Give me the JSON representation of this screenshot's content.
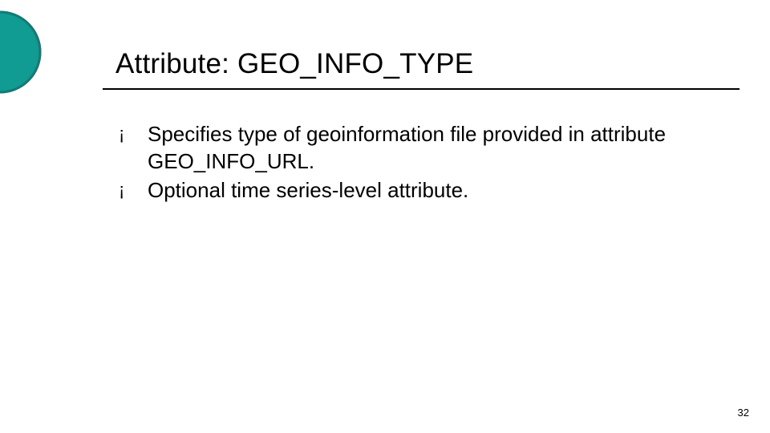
{
  "slide": {
    "title": "Attribute: GEO_INFO_TYPE",
    "bullets": [
      "Specifies type of geoinformation file provided in attribute GEO_INFO_URL.",
      "Optional time series-level attribute."
    ],
    "page_number": "32",
    "bullet_glyph": "¡"
  },
  "theme": {
    "accent": "#0d7d77",
    "accent_fill": "#109b93"
  }
}
